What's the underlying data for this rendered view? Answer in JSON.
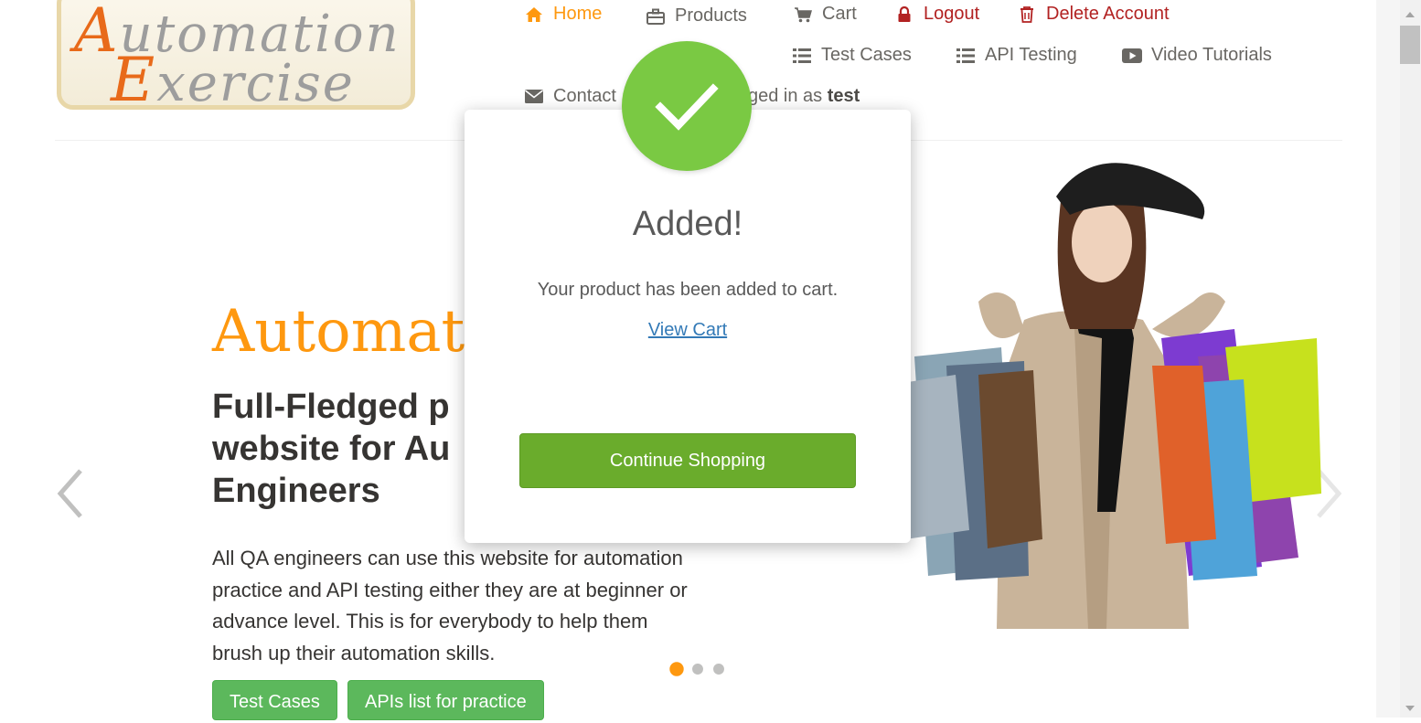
{
  "logo": {
    "line1_cap": "A",
    "line1_rest": "utomation",
    "line2_cap": "E",
    "line2_rest": "xercise"
  },
  "nav": {
    "home": "Home",
    "products": "Products",
    "cart": "Cart",
    "logout": "Logout",
    "delete_account": "Delete Account",
    "test_cases": "Test Cases",
    "api_testing": "API Testing",
    "video_tutorials": "Video Tutorials",
    "contact": "Contact",
    "logged_in_prefix": "ged in as",
    "username": "test"
  },
  "hero": {
    "brand": "Automatic",
    "subtitle_lines": [
      "Full-Fledged p",
      "website for Au",
      "Engineers"
    ],
    "description_lines": [
      "All QA engineers can use this website for automation",
      "practice and API testing either they are at beginner or",
      "advance level. This is for everybody to help them",
      "brush up their automation skills."
    ],
    "btn_test_cases": "Test Cases",
    "btn_apis": "APIs list for practice",
    "active_slide": 1,
    "slide_count": 3
  },
  "modal": {
    "title": "Added!",
    "message": "Your product has been added to cart.",
    "link": "View Cart",
    "button": "Continue Shopping"
  },
  "colors": {
    "accent": "#fe980f",
    "danger": "#b22222",
    "success": "#7ac943",
    "button_green": "#6aac2c",
    "link": "#337ab7"
  },
  "icons": {
    "home": "home-icon",
    "products": "briefcase-icon",
    "cart": "shopping-cart-icon",
    "logout": "lock-icon",
    "delete": "trash-icon",
    "test_cases": "list-icon",
    "api": "list-icon",
    "video": "youtube-play-icon",
    "contact": "envelope-icon"
  }
}
